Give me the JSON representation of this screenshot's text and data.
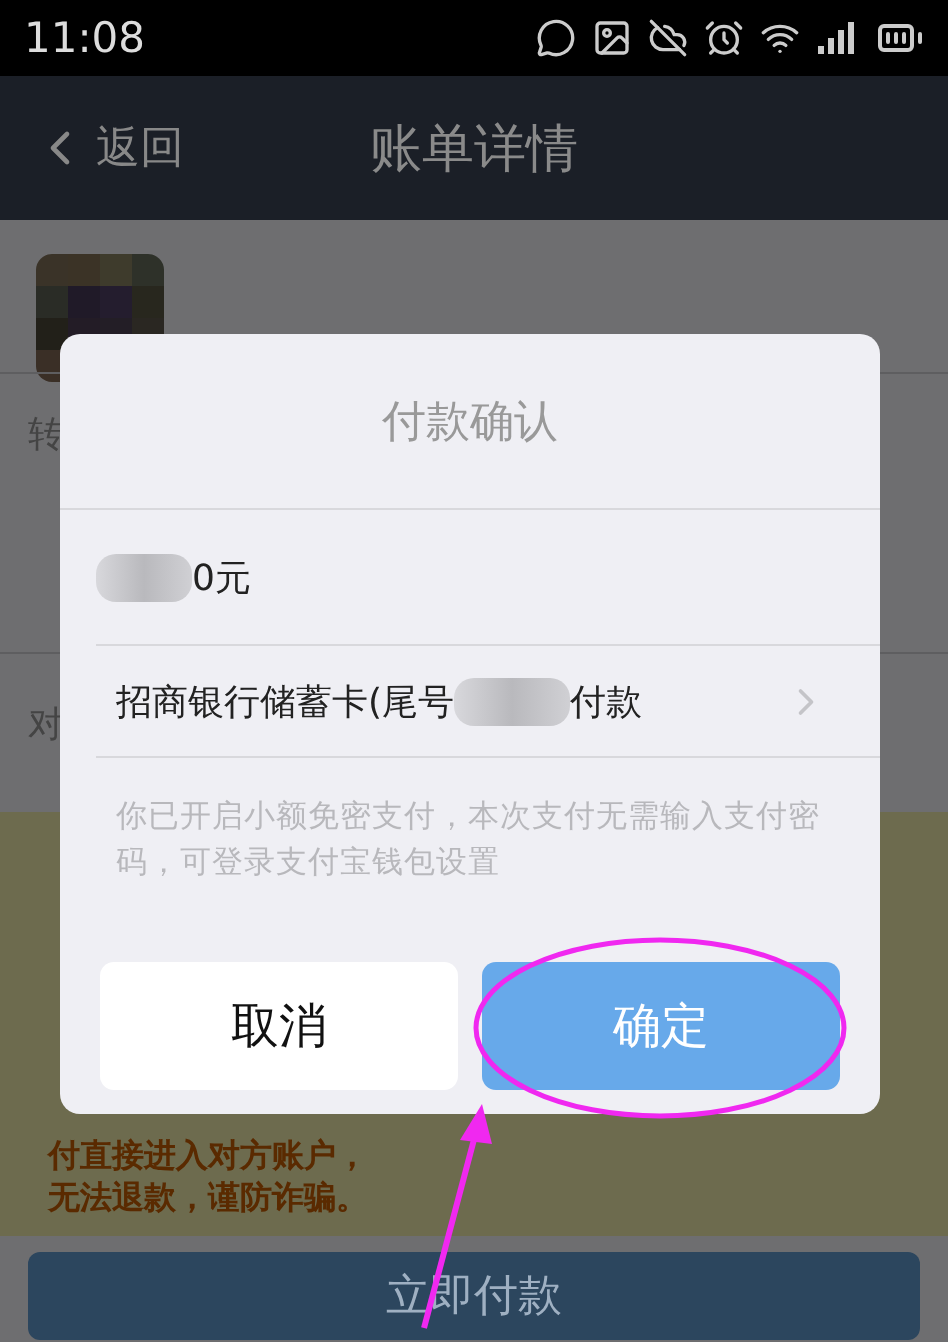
{
  "status_bar": {
    "time": "11:08"
  },
  "nav": {
    "back_label": "返回",
    "title": "账单详情"
  },
  "rows": [
    {
      "label": "转"
    },
    {
      "label": "对"
    }
  ],
  "warning": "付直接进入对方账户，无法退款，谨防诈骗。",
  "pay_button": "立即付款",
  "dialog": {
    "title": "付款确认",
    "amount": "0元",
    "card_prefix": "招商银行储蓄卡(尾号",
    "card_suffix": "付款",
    "message": "你已开启小额免密支付，本次支付无需输入支付密码，可登录支付宝钱包设置",
    "buttons": [
      {
        "label": "取消",
        "kind": "cancel"
      },
      {
        "label": "确定",
        "kind": "confirm"
      }
    ]
  }
}
